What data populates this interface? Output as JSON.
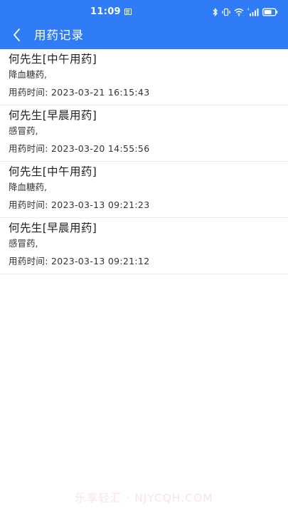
{
  "status_bar": {
    "time": "11:09",
    "icons": [
      "sim-card-icon",
      "bluetooth-icon",
      "vibrate-icon",
      "wifi-icon",
      "signal-icon",
      "battery-icon"
    ]
  },
  "header": {
    "title": "用药记录",
    "back_icon": "chevron-left-icon",
    "background_color": "#2f7cf6"
  },
  "records": [
    {
      "title": "何先生[中午用药]",
      "drug": "降血糖药,",
      "time": "用药时间:  2023-03-21 16:15:43"
    },
    {
      "title": "何先生[早晨用药]",
      "drug": "感冒药,",
      "time": "用药时间:  2023-03-20 14:55:56"
    },
    {
      "title": "何先生[中午用药]",
      "drug": "降血糖药,",
      "time": "用药时间:  2023-03-13 09:21:23"
    },
    {
      "title": "何先生[早晨用药]",
      "drug": "感冒药,",
      "time": "用药时间:  2023-03-13 09:21:12"
    }
  ],
  "watermark": "乐享轻汇 · NJYCQH.COM"
}
